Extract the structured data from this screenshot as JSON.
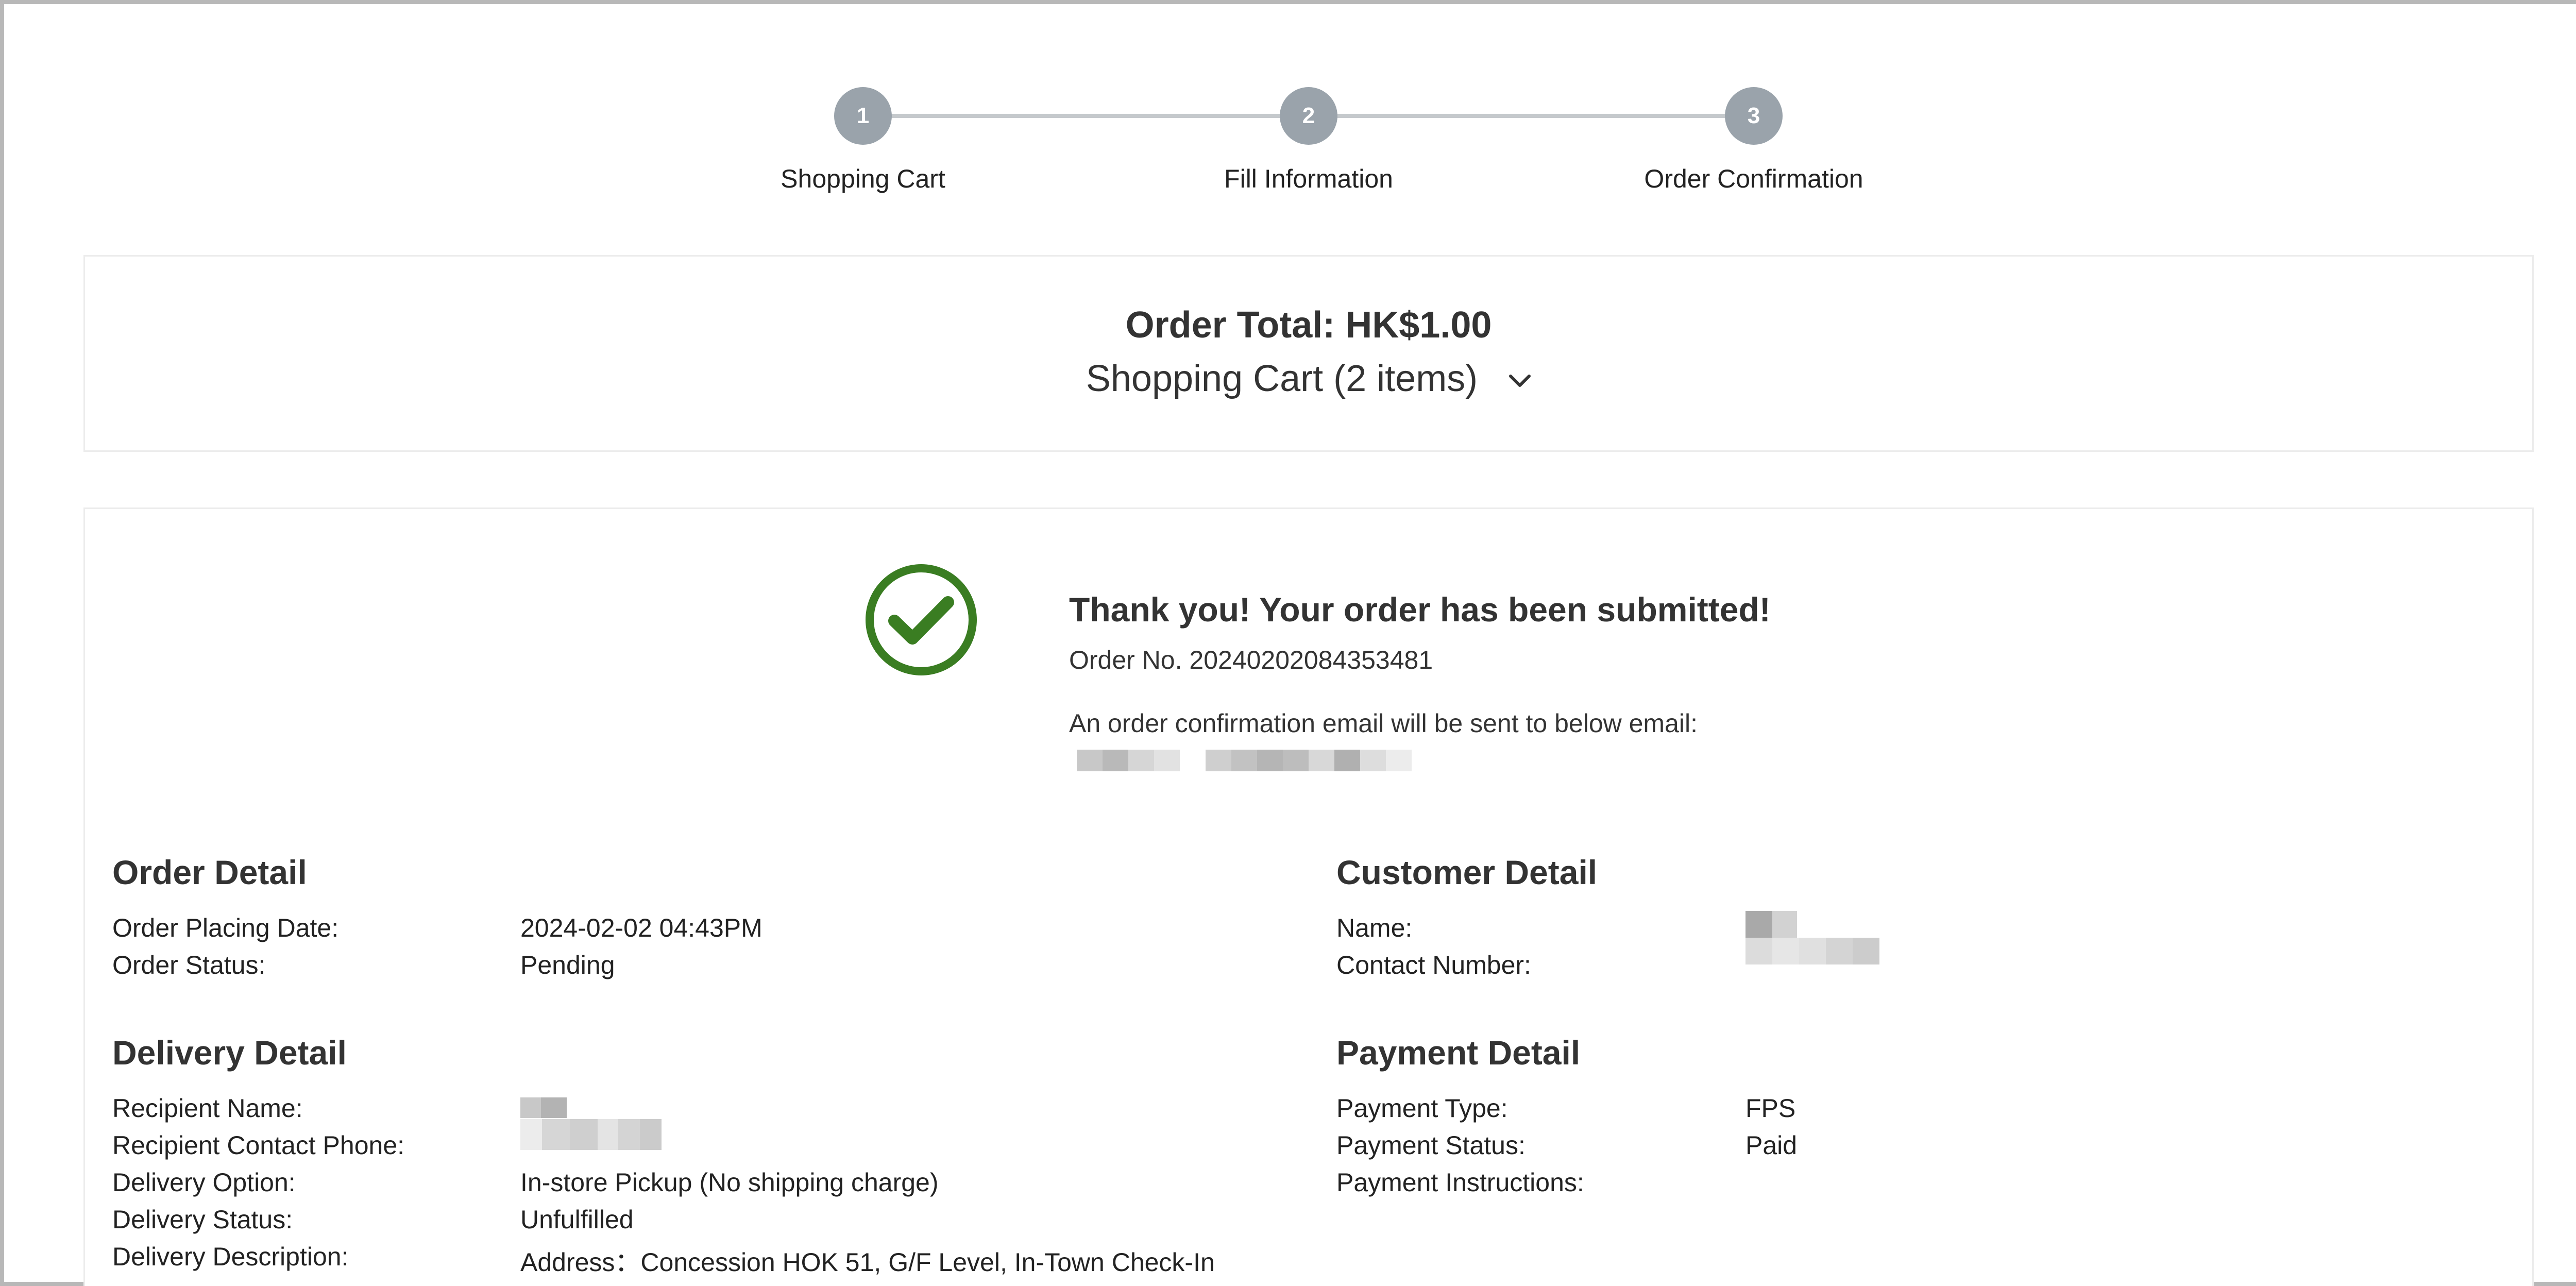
{
  "stepper": {
    "steps": [
      {
        "number": "1",
        "label": "Shopping Cart"
      },
      {
        "number": "2",
        "label": "Fill Information"
      },
      {
        "number": "3",
        "label": "Order Confirmation"
      }
    ]
  },
  "summary": {
    "order_total": "Order Total: HK$1.00",
    "cart_toggle": "Shopping Cart (2 items)"
  },
  "confirmation": {
    "title": "Thank you! Your order has been submitted!",
    "order_no": "Order No. 20240202084353481",
    "email_note": "An order confirmation email will be sent to below email:"
  },
  "order_detail": {
    "title": "Order Detail",
    "rows": [
      {
        "label": "Order Placing Date:",
        "value": "2024-02-02 04:43PM"
      },
      {
        "label": "Order Status:",
        "value": "Pending"
      }
    ]
  },
  "customer_detail": {
    "title": "Customer Detail",
    "rows": [
      {
        "label": "Name:"
      },
      {
        "label": "Contact Number:"
      }
    ]
  },
  "delivery_detail": {
    "title": "Delivery Detail",
    "rows": [
      {
        "label": "Recipient Name:"
      },
      {
        "label": "Recipient Contact Phone:"
      },
      {
        "label": "Delivery Option:",
        "value": "In-store Pickup (No shipping charge)"
      },
      {
        "label": "Delivery Status:",
        "value": "Unfulfilled"
      },
      {
        "label": "Delivery Description:",
        "value": "Address：Concession HOK 51, G/F Level, In-Town Check-In"
      }
    ]
  },
  "payment_detail": {
    "title": "Payment Detail",
    "rows": [
      {
        "label": "Payment Type:",
        "value": "FPS"
      },
      {
        "label": "Payment Status:",
        "value": "Paid"
      },
      {
        "label": "Payment Instructions:",
        "value": ""
      }
    ]
  },
  "colors": {
    "success": "#3a7d22",
    "step_circle": "#9aa3ab",
    "step_line": "#c5c9cc",
    "text": "#333333"
  },
  "icons": {
    "success": "check-circle-icon",
    "toggle": "chevron-down-icon"
  }
}
